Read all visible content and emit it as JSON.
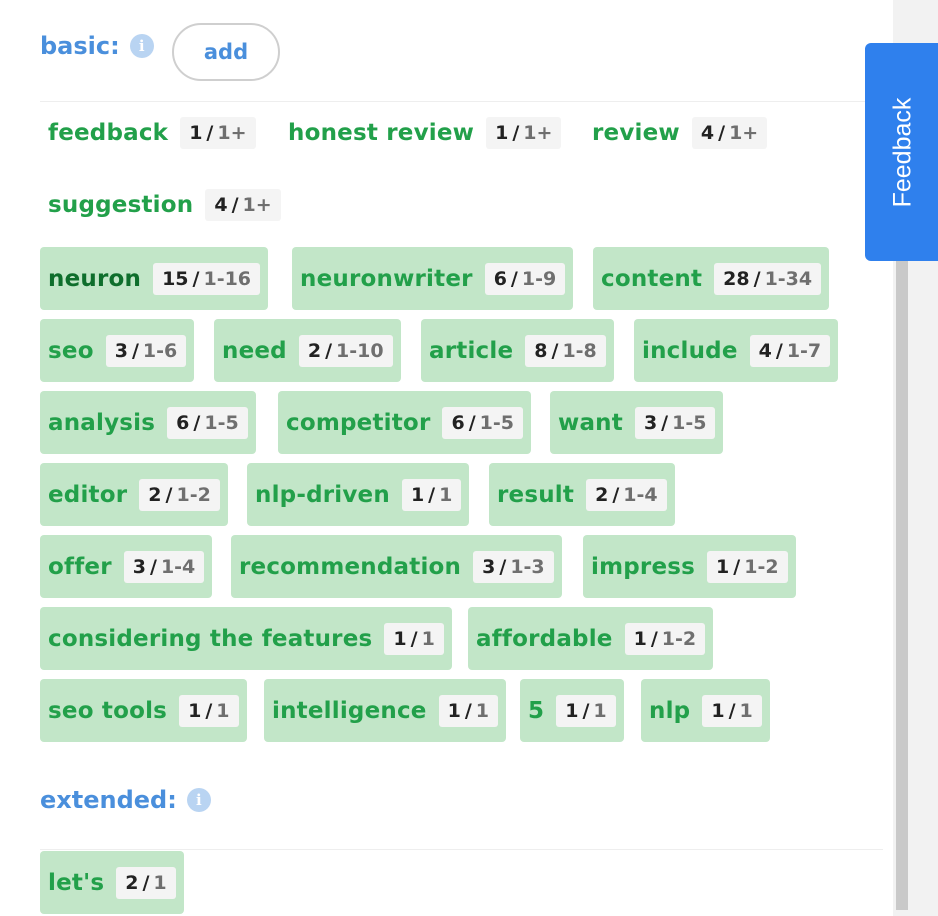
{
  "basic": {
    "heading": "basic:",
    "info_icon": "info-icon",
    "add_label": "add"
  },
  "extended": {
    "heading": "extended:",
    "info_icon": "info-icon"
  },
  "feedback_tab": {
    "label": "Feedback"
  },
  "colors": {
    "accent": "#4a8fdc",
    "tag_bg": "#c2e6c8",
    "term_green": "#22a04a",
    "term_dark": "#0e6e2c",
    "feedback_blue": "#2f80ed"
  },
  "plain_terms": [
    {
      "term": "feedback",
      "used": "1",
      "range": "1+"
    },
    {
      "term": "honest review",
      "used": "1",
      "range": "1+"
    },
    {
      "term": "review",
      "used": "4",
      "range": "1+"
    },
    {
      "term": "suggestion",
      "used": "4",
      "range": "1+"
    }
  ],
  "basic_terms": [
    {
      "term": "neuron",
      "used": "15",
      "range": "1-16"
    },
    {
      "term": "neuronwriter",
      "used": "6",
      "range": "1-9"
    },
    {
      "term": "content",
      "used": "28",
      "range": "1-34"
    },
    {
      "term": "seo",
      "used": "3",
      "range": "1-6"
    },
    {
      "term": "need",
      "used": "2",
      "range": "1-10"
    },
    {
      "term": "article",
      "used": "8",
      "range": "1-8"
    },
    {
      "term": "include",
      "used": "4",
      "range": "1-7"
    },
    {
      "term": "analysis",
      "used": "6",
      "range": "1-5"
    },
    {
      "term": "competitor",
      "used": "6",
      "range": "1-5"
    },
    {
      "term": "want",
      "used": "3",
      "range": "1-5"
    },
    {
      "term": "editor",
      "used": "2",
      "range": "1-2"
    },
    {
      "term": "nlp-driven",
      "used": "1",
      "range": "1"
    },
    {
      "term": "result",
      "used": "2",
      "range": "1-4"
    },
    {
      "term": "offer",
      "used": "3",
      "range": "1-4"
    },
    {
      "term": "recommendation",
      "used": "3",
      "range": "1-3"
    },
    {
      "term": "impress",
      "used": "1",
      "range": "1-2"
    },
    {
      "term": "considering the features",
      "used": "1",
      "range": "1"
    },
    {
      "term": "affordable",
      "used": "1",
      "range": "1-2"
    },
    {
      "term": "seo tools",
      "used": "1",
      "range": "1"
    },
    {
      "term": "intelligence",
      "used": "1",
      "range": "1"
    },
    {
      "term": "5",
      "used": "1",
      "range": "1"
    },
    {
      "term": "nlp",
      "used": "1",
      "range": "1"
    }
  ],
  "extended_terms": [
    {
      "term": "let's",
      "used": "2",
      "range": "1"
    }
  ]
}
